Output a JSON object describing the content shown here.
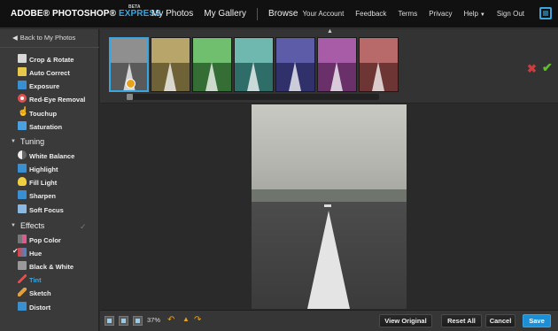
{
  "header": {
    "brand": "ADOBE® PHOTOSHOP®",
    "brand_express": "EXPRESS",
    "brand_beta": "BETA",
    "nav_left": [
      "My Photos",
      "My Gallery",
      "Browse"
    ],
    "nav_right": [
      "Your Account",
      "Feedback",
      "Terms",
      "Privacy",
      "Help",
      "Sign Out"
    ]
  },
  "sidebar": {
    "back_label": "Back to My Photos",
    "basics": [
      {
        "label": "Crop & Rotate",
        "icon": "crop-icon",
        "color": "#d8d8d8"
      },
      {
        "label": "Auto Correct",
        "icon": "wand-icon",
        "color": "#e8c84a"
      },
      {
        "label": "Exposure",
        "icon": "exposure-icon",
        "color": "#3a8fd0"
      },
      {
        "label": "Red-Eye Removal",
        "icon": "eye-icon",
        "color": "#e05050"
      },
      {
        "label": "Touchup",
        "icon": "hand-icon",
        "color": "#ffffff"
      },
      {
        "label": "Saturation",
        "icon": "saturation-icon",
        "color": "#4aa0e0"
      }
    ],
    "tuning_label": "Tuning",
    "tuning": [
      {
        "label": "White Balance",
        "icon": "white-balance-icon",
        "color": "#aaaaaa"
      },
      {
        "label": "Highlight",
        "icon": "highlight-icon",
        "color": "#3a8fd0"
      },
      {
        "label": "Fill Light",
        "icon": "bulb-icon",
        "color": "#f0d040"
      },
      {
        "label": "Sharpen",
        "icon": "sharpen-icon",
        "color": "#3a8fd0"
      },
      {
        "label": "Soft Focus",
        "icon": "soft-focus-icon",
        "color": "#8ab8e0"
      }
    ],
    "effects_label": "Effects",
    "effects": [
      {
        "label": "Pop Color",
        "icon": "pop-color-icon",
        "color": "#e05a90"
      },
      {
        "label": "Hue",
        "icon": "hue-icon",
        "color": "#e04040"
      },
      {
        "label": "Black & White",
        "icon": "bw-icon",
        "color": "#999999"
      },
      {
        "label": "Tint",
        "icon": "tint-icon",
        "color": "#e05050"
      },
      {
        "label": "Sketch",
        "icon": "sketch-icon",
        "color": "#e0a040"
      },
      {
        "label": "Distort",
        "icon": "distort-icon",
        "color": "#3a8fd0"
      }
    ]
  },
  "filmstrip": {
    "thumbs": [
      {
        "sky": "#8f8f8f",
        "road": "#5a5a5a"
      },
      {
        "sky": "#b8a56a",
        "road": "#6e6236"
      },
      {
        "sky": "#6fbf6f",
        "road": "#356e35"
      },
      {
        "sky": "#6fb8b0",
        "road": "#2f6e68"
      },
      {
        "sky": "#5c5ca8",
        "road": "#30306a"
      },
      {
        "sky": "#a85ca8",
        "road": "#6a306a"
      },
      {
        "sky": "#b86a6a",
        "road": "#6e3535"
      }
    ],
    "selected_index": 0
  },
  "bottom": {
    "zoom": "37%",
    "view_original": "View Original",
    "reset_all": "Reset All",
    "cancel": "Cancel",
    "save": "Save"
  },
  "colors": {
    "accent": "#39a6e0",
    "save": "#1c8fd6",
    "cancel_x": "#d23b3b",
    "accept": "#5fbf2f"
  }
}
